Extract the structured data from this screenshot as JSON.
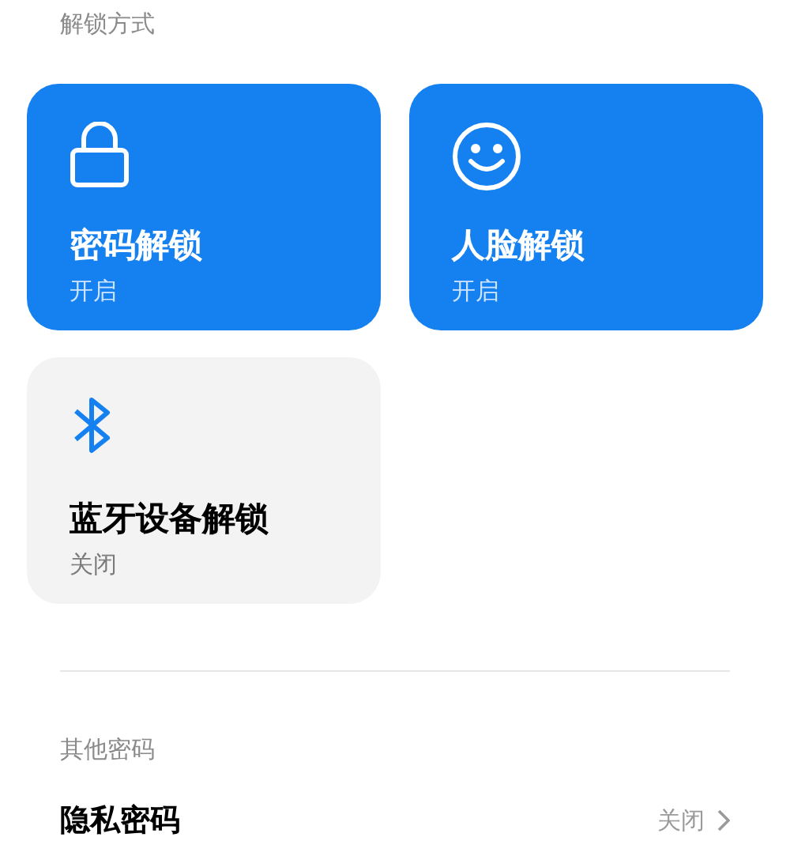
{
  "unlock_section": {
    "title": "解锁方式",
    "cards": [
      {
        "kind": "lock",
        "title": "密码解锁",
        "status": "开启",
        "on": true
      },
      {
        "kind": "face",
        "title": "人脸解锁",
        "status": "开启",
        "on": true
      },
      {
        "kind": "bluetooth",
        "title": "蓝牙设备解锁",
        "status": "关闭",
        "on": false
      }
    ]
  },
  "other_section": {
    "title": "其他密码",
    "rows": [
      {
        "label": "隐私密码",
        "value": "关闭"
      }
    ]
  }
}
